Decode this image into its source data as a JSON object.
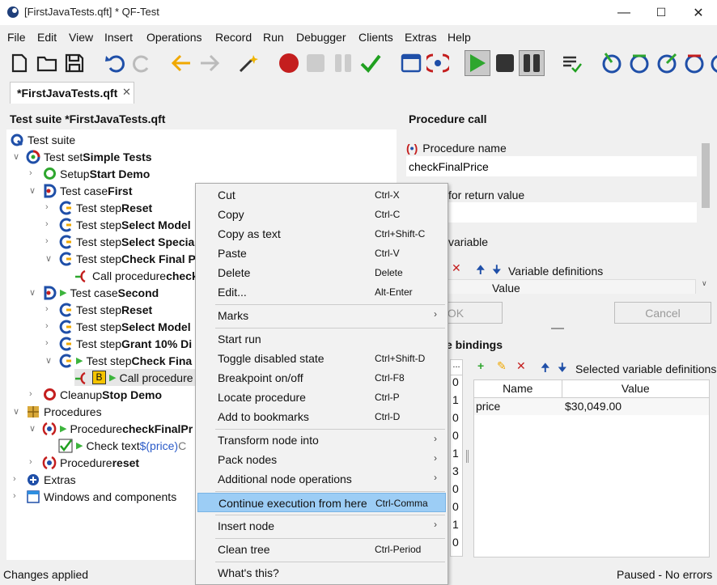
{
  "window": {
    "title": "[FirstJavaTests.qft] * QF-Test",
    "min": "—",
    "max": "☐",
    "close": "✕"
  },
  "menubar": [
    "File",
    "Edit",
    "View",
    "Insert",
    "Operations",
    "Record",
    "Run",
    "Debugger",
    "Clients",
    "Extras",
    "Help"
  ],
  "tab": {
    "label": "*FirstJavaTests.qft",
    "close": "✕"
  },
  "tree": {
    "heading": "Test suite *FirstJavaTests.qft",
    "n0": {
      "a": "Test suite"
    },
    "n1": {
      "a": "Test set ",
      "b": "Simple Tests"
    },
    "n2": {
      "a": "Setup ",
      "b": "Start Demo"
    },
    "n3": {
      "a": "Test case ",
      "b": "First"
    },
    "n4": {
      "a": "Test step ",
      "b": "Reset"
    },
    "n5": {
      "a": "Test step ",
      "b": "Select Model"
    },
    "n6": {
      "a": "Test step ",
      "b": "Select Special"
    },
    "n7": {
      "a": "Test step ",
      "b": "Check Final P"
    },
    "n8": {
      "a": "Call procedure ",
      "b": "check"
    },
    "n9": {
      "a": "Test case ",
      "b": "Second"
    },
    "n10": {
      "a": "Test step ",
      "b": "Reset"
    },
    "n11": {
      "a": "Test step ",
      "b": "Select Model"
    },
    "n12": {
      "a": "Test step ",
      "b": "Grant 10% Di"
    },
    "n13": {
      "a": "Test step ",
      "b": "Check Fina"
    },
    "n14": {
      "a": "Call procedure"
    },
    "n15": {
      "a": "Cleanup ",
      "b": "Stop Demo"
    },
    "n16": {
      "a": "Procedures"
    },
    "n17": {
      "a": "Procedure ",
      "b": "checkFinalPr"
    },
    "n18": {
      "a": "Check text ",
      "c": "$(price)",
      "d": " C"
    },
    "n19": {
      "a": "Procedure ",
      "b": "reset"
    },
    "n20": {
      "a": "Extras"
    },
    "n21": {
      "a": "Windows and components"
    },
    "badge": "B"
  },
  "detail": {
    "heading": "Procedure call",
    "procName_label": "Procedure name",
    "procName_value": "checkFinalPrice",
    "returnVar_label": "for return value",
    "localVar_label": "variable",
    "varDefs_label": "Variable definitions",
    "value_col": "Value",
    "ok": "OK",
    "cancel": "Cancel",
    "bindings_label": "e bindings",
    "selected_label": "Selected variable definitions",
    "left_col_hdr": "...",
    "left_col": [
      "0",
      "1",
      "0",
      "0",
      "1",
      "3",
      "0",
      "0",
      "1",
      "0"
    ],
    "table": {
      "headers": [
        "Name",
        "Value"
      ],
      "rows": [
        {
          "name": "price",
          "value": "$30,049.00"
        }
      ]
    }
  },
  "context_menu": [
    {
      "label": "Cut",
      "shortcut": "Ctrl-X"
    },
    {
      "label": "Copy",
      "shortcut": "Ctrl-C"
    },
    {
      "label": "Copy as text",
      "shortcut": "Ctrl+Shift-C"
    },
    {
      "label": "Paste",
      "shortcut": "Ctrl-V"
    },
    {
      "label": "Delete",
      "shortcut": "Delete"
    },
    {
      "label": "Edit...",
      "shortcut": "Alt-Enter"
    },
    {
      "label": "Marks",
      "shortcut": ""
    },
    {
      "label": "Start run",
      "shortcut": ""
    },
    {
      "label": "Toggle disabled state",
      "shortcut": "Ctrl+Shift-D"
    },
    {
      "label": "Breakpoint on/off",
      "shortcut": "Ctrl-F8"
    },
    {
      "label": "Locate procedure",
      "shortcut": "Ctrl-P"
    },
    {
      "label": "Add to bookmarks",
      "shortcut": "Ctrl-D"
    },
    {
      "label": "Transform node into",
      "shortcut": ""
    },
    {
      "label": "Pack nodes",
      "shortcut": ""
    },
    {
      "label": "Additional node operations",
      "shortcut": ""
    },
    {
      "label": "Continue execution from here",
      "shortcut": "Ctrl-Comma"
    },
    {
      "label": "Insert node",
      "shortcut": ""
    },
    {
      "label": "Clean tree",
      "shortcut": "Ctrl-Period"
    },
    {
      "label": "What's this?",
      "shortcut": ""
    }
  ],
  "submenu_glyph": "›",
  "status": {
    "left": "Changes applied",
    "right": "Paused - No errors"
  },
  "colors": {
    "highlight": "#9ccdf5",
    "record": "#c41e1e",
    "play": "#2ea62e",
    "qftest_blue": "#1f4fa8"
  }
}
